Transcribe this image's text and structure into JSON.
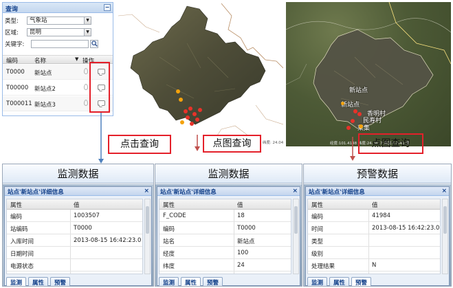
{
  "query_panel": {
    "title": "查询",
    "collapse_glyph": "−",
    "type_label": "类型:",
    "type_value": "气象站",
    "area_label": "区域:",
    "area_value": "昆明",
    "keyword_label": "关键字:",
    "keyword_value": "",
    "search_icon": "magnifier-icon",
    "columns": [
      "编码",
      "名称",
      "操作"
    ],
    "rows": [
      {
        "code": "T0000",
        "name": "新站点"
      },
      {
        "code": "T00000",
        "name": "新站点2"
      },
      {
        "code": "T000011",
        "name": "新站点3"
      }
    ]
  },
  "map1": {
    "coordinate": "经度:101.78 纬度: 24.04631"
  },
  "map2": {
    "labels": [
      "新站点",
      "新站点",
      "香明村",
      "民寿村",
      "菜集"
    ],
    "coordinate": "经度:101.4148 纬度:24.0417 海拔:1204公里"
  },
  "callouts": {
    "click_query": "点击查询",
    "map_query_1": "点图查询",
    "map_query_2": "点图查询"
  },
  "panels": [
    {
      "heading": "监测数据",
      "window_title": "站点'新站点'详细信息",
      "close_glyph": "×",
      "table_header": {
        "key": "属性",
        "value": "值"
      },
      "rows": [
        {
          "key": "编码",
          "value": "1003507"
        },
        {
          "key": "站编码",
          "value": "T0000"
        },
        {
          "key": "入库时间",
          "value": "2013-08-15 16:42:23.0"
        },
        {
          "key": "日期时间",
          "value": ""
        },
        {
          "key": "电源状态",
          "value": ""
        }
      ],
      "tabs": [
        "监测",
        "属性",
        "预警"
      ],
      "active_tab": 0
    },
    {
      "heading": "监测数据",
      "window_title": "站点'新站点'详细信息",
      "close_glyph": "×",
      "table_header": {
        "key": "属性",
        "value": "值"
      },
      "rows": [
        {
          "key": "F_CODE",
          "value": "18"
        },
        {
          "key": "编码",
          "value": "T0000"
        },
        {
          "key": "站名",
          "value": "新站点"
        },
        {
          "key": "经度",
          "value": "100"
        },
        {
          "key": "纬度",
          "value": "24"
        }
      ],
      "tabs": [
        "监测",
        "属性",
        "预警"
      ],
      "active_tab": 1
    },
    {
      "heading": "预警数据",
      "window_title": "站点'新站点'详细信息",
      "close_glyph": "×",
      "table_header": {
        "key": "属性",
        "value": "值"
      },
      "rows": [
        {
          "key": "编码",
          "value": "41984"
        },
        {
          "key": "时间",
          "value": "2013-08-15 16:42:23.0"
        },
        {
          "key": "类型",
          "value": ""
        },
        {
          "key": "级别",
          "value": ""
        },
        {
          "key": "处理结果",
          "value": "N"
        }
      ],
      "tabs": [
        "监测",
        "属性",
        "预警"
      ],
      "active_tab": 2
    }
  ],
  "colors": {
    "highlight_red": "#e4202a",
    "arrow_blue": "#4f81bd",
    "arrow_red": "#c0504d",
    "station_red": "#e8322a",
    "station_orange": "#f4a20c"
  }
}
